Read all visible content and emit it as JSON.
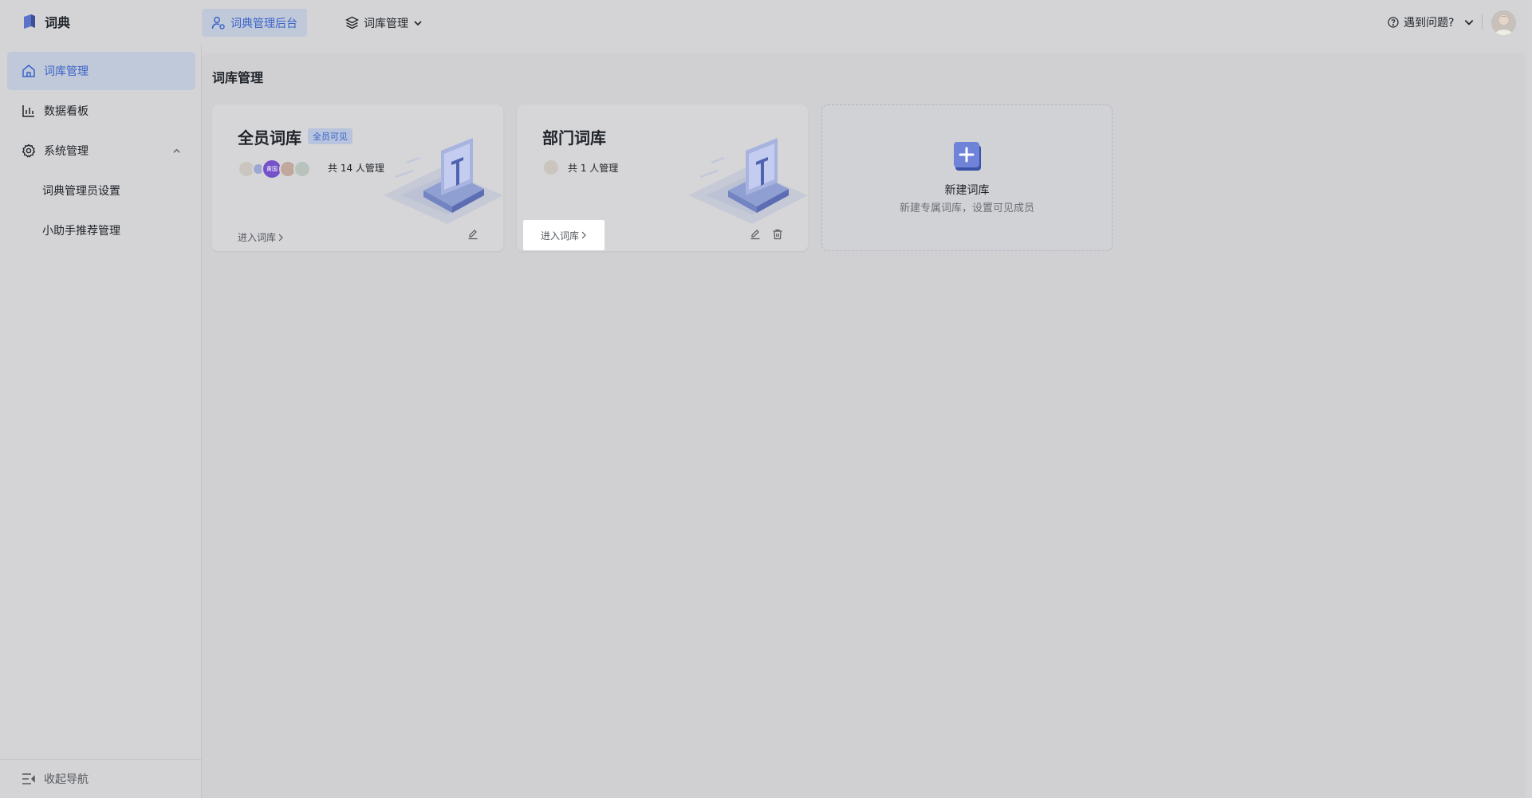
{
  "header": {
    "brand": "词典",
    "admin_tab": "词典管理后台",
    "library_menu": "词库管理",
    "help": "遇到问题?"
  },
  "sidebar": {
    "items": [
      {
        "label": "词库管理",
        "icon": "home-icon",
        "active": true
      },
      {
        "label": "数据看板",
        "icon": "bar-chart-icon"
      },
      {
        "label": "系统管理",
        "icon": "gear-icon",
        "expanded": true
      }
    ],
    "sub_items": [
      {
        "label": "词典管理员设置"
      },
      {
        "label": "小助手推荐管理"
      }
    ],
    "collapse_label": "收起导航"
  },
  "main": {
    "title": "词库管理",
    "cards": [
      {
        "title": "全员词库",
        "badge": "全员可见",
        "managers": "共 14 人管理",
        "avatar_text": "黄国",
        "enter": "进入词库"
      },
      {
        "title": "部门词库",
        "managers": "共 1 人管理",
        "enter": "进入词库"
      }
    ],
    "new_card": {
      "title": "新建词库",
      "subtitle": "新建专属词库，设置可见成员"
    }
  },
  "colors": {
    "accent": "#3a63c8",
    "active_bg": "#c0c9d9",
    "badge_bg": "#b8c4dd"
  }
}
